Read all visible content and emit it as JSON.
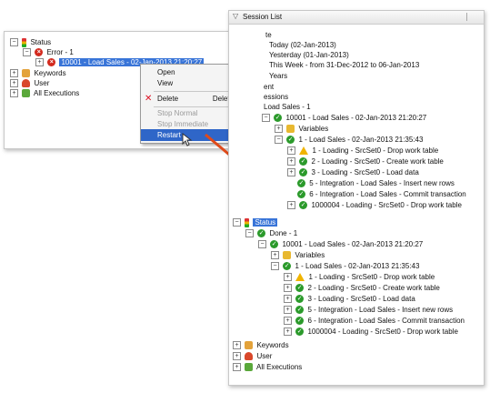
{
  "left_tree": {
    "status": "Status",
    "error": "Error - 1",
    "session": "10001 - Load Sales - 02-Jan-2013 21:20:27",
    "keywords": "Keywords",
    "user": "User",
    "all": "All Executions"
  },
  "context_menu": {
    "open": "Open",
    "view": "View",
    "delete": "Delete",
    "delete_shortcut": "Delete",
    "stop_normal": "Stop Normal",
    "stop_immediate": "Stop Immediate",
    "restart": "Restart"
  },
  "session_list": {
    "title": "Session List",
    "partial": {
      "te": "te",
      "today": "Today (02-Jan-2013)",
      "yesterday": "Yesterday (01-Jan-2013)",
      "this_week": "This Week - from 31-Dec-2012 to 06-Jan-2013",
      "years": "Years",
      "ent": "ent",
      "essions": "essions",
      "load_sales": "Load Sales - 1"
    },
    "top": {
      "session": "10001 - Load Sales - 02-Jan-2013 21:20:27",
      "variables": "Variables",
      "step": "1 - Load Sales - 02-Jan-2013 21:35:43",
      "tasks": [
        "1 - Loading - SrcSet0 - Drop work table",
        "2 - Loading - SrcSet0 - Create work table",
        "3 - Loading - SrcSet0 - Load data",
        "5 - Integration - Load Sales - Insert new rows",
        "6 - Integration - Load Sales - Commit transaction",
        "1000004 - Loading - SrcSet0 - Drop work table"
      ]
    },
    "status": "Status",
    "done": "Done - 1",
    "bottom": {
      "session": "10001 - Load Sales - 02-Jan-2013 21:20:27",
      "variables": "Variables",
      "step": "1 - Load Sales - 02-Jan-2013 21:35:43",
      "tasks": [
        "1 - Loading - SrcSet0 - Drop work table",
        "2 - Loading - SrcSet0 - Create work table",
        "3 - Loading - SrcSet0 - Load data",
        "5 - Integration - Load Sales - Insert new rows",
        "6 - Integration - Load Sales - Commit transaction",
        "1000004 - Loading - SrcSet0 - Drop work table"
      ]
    },
    "keywords": "Keywords",
    "user": "User",
    "all": "All Executions"
  }
}
